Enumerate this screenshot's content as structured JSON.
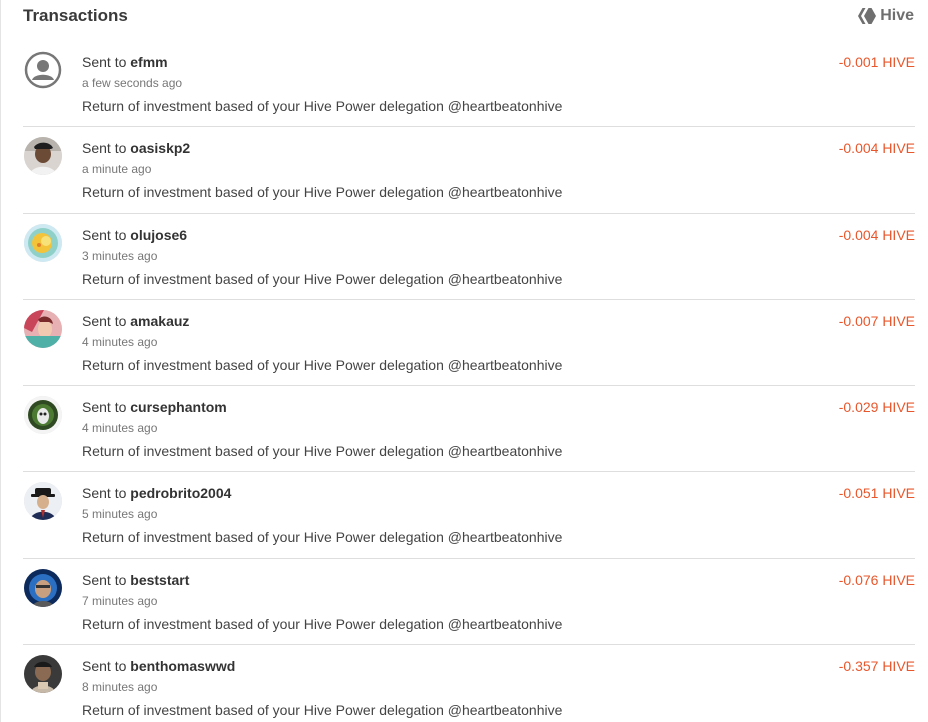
{
  "header": {
    "title": "Transactions",
    "brand_label": "Hive",
    "brand_icon": "hive-logo-icon"
  },
  "colors": {
    "amount": "#e8572c",
    "divider": "#dedede"
  },
  "transactions": [
    {
      "prefix": "Sent to",
      "user": "efmm",
      "time": "a few seconds ago",
      "memo": "Return of investment based of your Hive Power delegation @heartbeatonhive",
      "amount": "-0.001 HIVE",
      "avatar": "default-avatar-icon"
    },
    {
      "prefix": "Sent to",
      "user": "oasiskp2",
      "time": "a minute ago",
      "memo": "Return of investment based of your Hive Power delegation @heartbeatonhive",
      "amount": "-0.004 HIVE",
      "avatar": "user-photo"
    },
    {
      "prefix": "Sent to",
      "user": "olujose6",
      "time": "3 minutes ago",
      "memo": "Return of investment based of your Hive Power delegation @heartbeatonhive",
      "amount": "-0.004 HIVE",
      "avatar": "user-photo"
    },
    {
      "prefix": "Sent to",
      "user": "amakauz",
      "time": "4 minutes ago",
      "memo": "Return of investment based of your Hive Power delegation @heartbeatonhive",
      "amount": "-0.007 HIVE",
      "avatar": "user-photo"
    },
    {
      "prefix": "Sent to",
      "user": "cursephantom",
      "time": "4 minutes ago",
      "memo": "Return of investment based of your Hive Power delegation @heartbeatonhive",
      "amount": "-0.029 HIVE",
      "avatar": "user-photo"
    },
    {
      "prefix": "Sent to",
      "user": "pedrobrito2004",
      "time": "5 minutes ago",
      "memo": "Return of investment based of your Hive Power delegation @heartbeatonhive",
      "amount": "-0.051 HIVE",
      "avatar": "user-photo"
    },
    {
      "prefix": "Sent to",
      "user": "beststart",
      "time": "7 minutes ago",
      "memo": "Return of investment based of your Hive Power delegation @heartbeatonhive",
      "amount": "-0.076 HIVE",
      "avatar": "user-photo"
    },
    {
      "prefix": "Sent to",
      "user": "benthomaswwd",
      "time": "8 minutes ago",
      "memo": "Return of investment based of your Hive Power delegation @heartbeatonhive",
      "amount": "-0.357 HIVE",
      "avatar": "user-photo"
    }
  ]
}
